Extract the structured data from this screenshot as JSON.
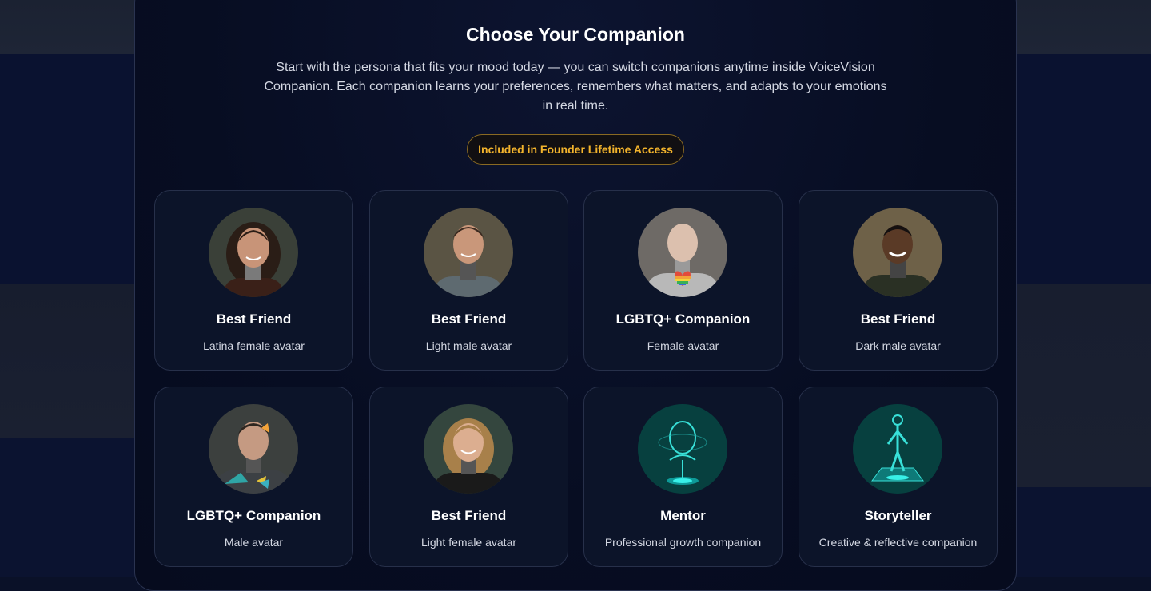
{
  "section": {
    "title": "Choose Your Companion",
    "subtitle": "Start with the persona that fits your mood today — you can switch companions anytime inside VoiceVision Companion. Each companion learns your preferences, remembers what matters, and adapts to your emotions in real time.",
    "badge": "Included in Founder Lifetime Access"
  },
  "companions": [
    {
      "title": "Best Friend",
      "subtitle": "Latina female avatar",
      "avatar": "latina-female-avatar"
    },
    {
      "title": "Best Friend",
      "subtitle": "Light male avatar",
      "avatar": "light-male-avatar"
    },
    {
      "title": "LGBTQ+ Companion",
      "subtitle": "Female avatar",
      "avatar": "lgbtq-female-avatar"
    },
    {
      "title": "Best Friend",
      "subtitle": "Dark male avatar",
      "avatar": "dark-male-avatar"
    },
    {
      "title": "LGBTQ+ Companion",
      "subtitle": "Male avatar",
      "avatar": "lgbtq-male-avatar"
    },
    {
      "title": "Best Friend",
      "subtitle": "Light female avatar",
      "avatar": "light-female-avatar"
    },
    {
      "title": "Mentor",
      "subtitle": "Professional growth companion",
      "avatar": "mentor-hologram-avatar"
    },
    {
      "title": "Storyteller",
      "subtitle": "Creative & reflective companion",
      "avatar": "storyteller-hologram-avatar"
    }
  ],
  "colors": {
    "accent": "#f3b42c",
    "card_bg": "#0c1429",
    "panel_bg": "#070d22"
  }
}
